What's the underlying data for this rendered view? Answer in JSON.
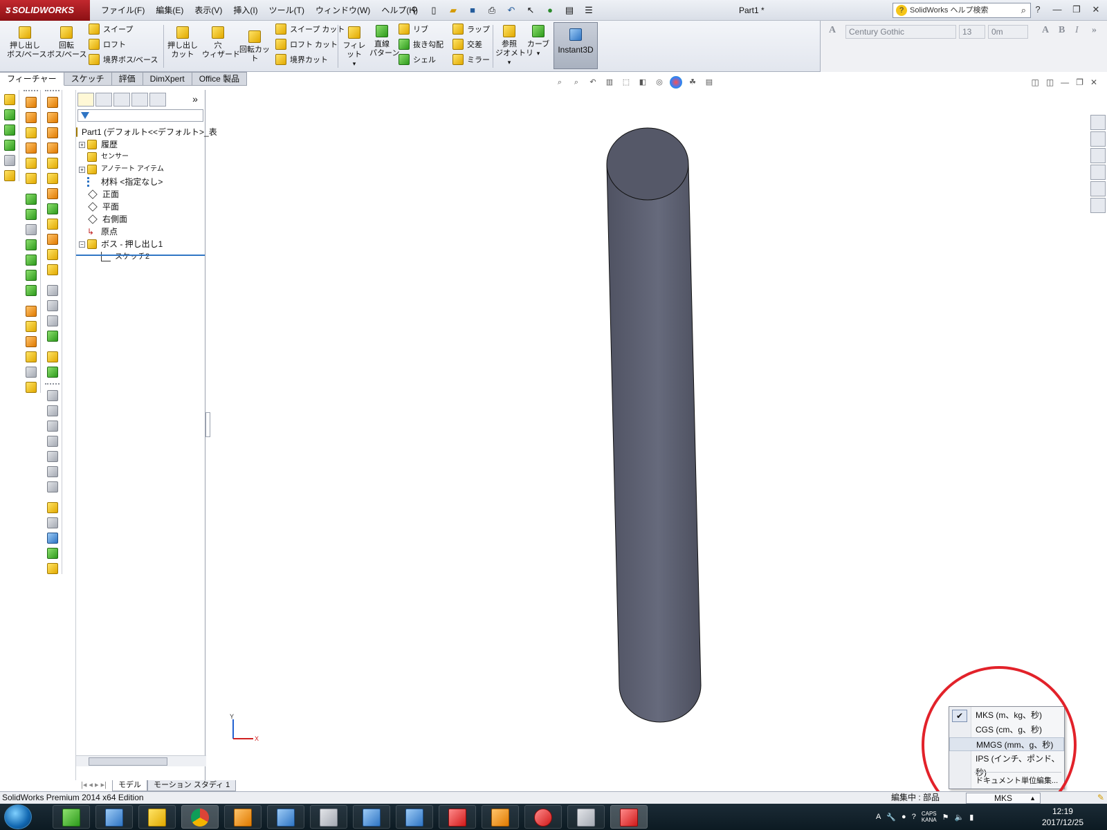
{
  "app": {
    "logo_text": "SOLIDWORKS",
    "document_title": "Part1 *",
    "menus": [
      "ファイル(F)",
      "編集(E)",
      "表示(V)",
      "挿入(I)",
      "ツール(T)",
      "ウィンドウ(W)",
      "ヘルプ(H)"
    ],
    "search_placeholder": "SolidWorks ヘルプ検索"
  },
  "features_toolbar": {
    "extrude_boss": "押し出し\nボス/ベース",
    "revolve_boss": "回転\nボス/ベース",
    "sweep": "スイープ",
    "loft": "ロフト",
    "boundary_boss": "境界ボス/ベース",
    "extrude_cut": "押し出し\nカット",
    "hole_wizard": "穴\nウィザード",
    "revolve_cut": "回転カット",
    "sweep_cut": "スイープ カット",
    "loft_cut": "ロフト カット",
    "boundary_cut": "境界カット",
    "fillet": "フィレット",
    "linear_pattern": "直線\nパターン",
    "rib": "リブ",
    "draft": "抜き勾配",
    "shell": "シェル",
    "wrap": "ラップ",
    "intersect": "交差",
    "mirror": "ミラー",
    "ref_geometry": "参照\nジオメトリ",
    "curves": "カーブ",
    "instant3d": "Instant3D"
  },
  "font_toolbar": {
    "font": "Century Gothic",
    "size": "13",
    "height": "0m"
  },
  "tabs": [
    {
      "label": "フィーチャー",
      "active": true
    },
    {
      "label": "スケッチ",
      "active": false
    },
    {
      "label": "評価",
      "active": false
    },
    {
      "label": "DimXpert",
      "active": false
    },
    {
      "label": "Office 製品",
      "active": false
    }
  ],
  "feature_tree": {
    "root": "Part1 (デフォルト<<デフォルト>_表",
    "items": [
      {
        "label": "履歴",
        "expand": true
      },
      {
        "label": "センサー",
        "expand": false
      },
      {
        "label": "アノテート アイテム",
        "expand": true
      },
      {
        "label": "材料 <指定なし>",
        "expand": false
      },
      {
        "label": "正面",
        "expand": false
      },
      {
        "label": "平面",
        "expand": false
      },
      {
        "label": "右側面",
        "expand": false
      },
      {
        "label": "原点",
        "expand": false
      },
      {
        "label": "ボス - 押し出し1",
        "expand": true
      },
      {
        "label": "スケッチ2",
        "expand": false
      }
    ]
  },
  "bottom_tabs": [
    "モデル",
    "モーション スタディ 1"
  ],
  "units_menu": {
    "items": [
      {
        "label": "MKS (m、kg、秒)",
        "checked": true
      },
      {
        "label": "CGS (cm、g、秒)",
        "checked": false
      },
      {
        "label": "MMGS (mm、g、秒)",
        "checked": false,
        "highlighted": true
      },
      {
        "label": "IPS (インチ、ポンド、秒)",
        "checked": false
      }
    ],
    "edit_units": "ドキュメント単位編集..."
  },
  "status_bar": {
    "edition": "SolidWorks Premium 2014 x64 Edition",
    "editing": "編集中 : 部品",
    "units": "MKS"
  },
  "triad": {
    "y": "Y",
    "x": "X"
  },
  "taskbar": {
    "tray_labels": [
      "A",
      "CAPS",
      "KANA"
    ],
    "time": "12:19",
    "date": "2017/12/25"
  },
  "colors": {
    "brand_red": "#c2282e",
    "cylinder": "#5b5e6e",
    "highlight_circle": "#e2222a"
  }
}
